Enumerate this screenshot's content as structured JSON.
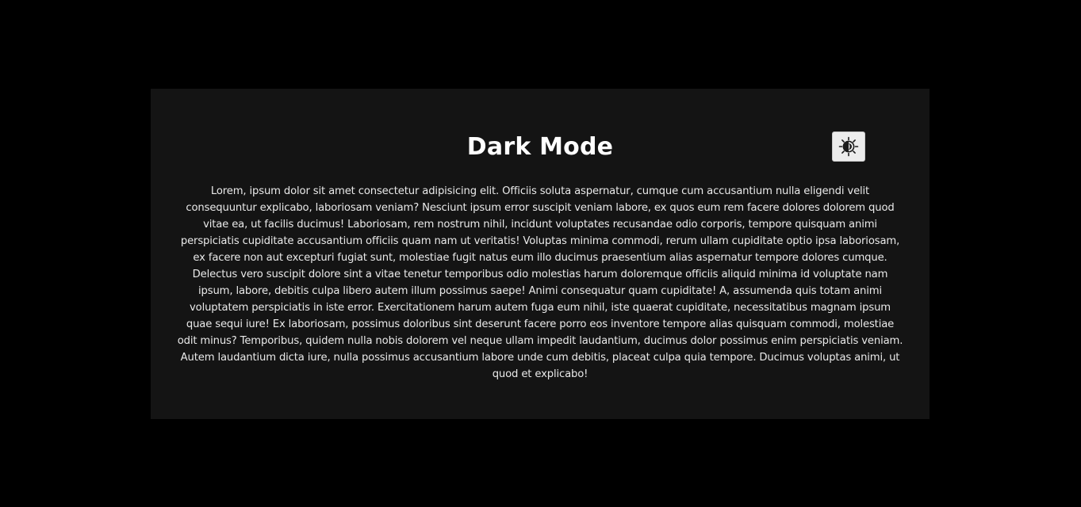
{
  "page": {
    "background": "#000000",
    "card_background": "#141414",
    "text_color": "#e9e9e9",
    "title_color": "#ffffff"
  },
  "header": {
    "title": "Dark Mode"
  },
  "theme_toggle": {
    "icon": "sun-moon-icon",
    "background": "#ececec"
  },
  "content": {
    "paragraph": "Lorem, ipsum dolor sit amet consectetur adipisicing elit. Officiis soluta aspernatur, cumque cum accusantium nulla eligendi velit consequuntur explicabo, laboriosam veniam? Nesciunt ipsum error suscipit veniam labore, ex quos eum rem facere dolores dolorem quod vitae ea, ut facilis ducimus! Laboriosam, rem nostrum nihil, incidunt voluptates recusandae odio corporis, tempore quisquam animi perspiciatis cupiditate accusantium officiis quam nam ut veritatis! Voluptas minima commodi, rerum ullam cupiditate optio ipsa laboriosam, ex facere non aut excepturi fugiat sunt, molestiae fugit natus eum illo ducimus praesentium alias aspernatur tempore dolores cumque. Delectus vero suscipit dolore sint a vitae tenetur temporibus odio molestias harum doloremque officiis aliquid minima id voluptate nam ipsum, labore, debitis culpa libero autem illum possimus saepe! Animi consequatur quam cupiditate! A, assumenda quis totam animi voluptatem perspiciatis in iste error. Exercitationem harum autem fuga eum nihil, iste quaerat cupiditate, necessitatibus magnam ipsum quae sequi iure! Ex laboriosam, possimus doloribus sint deserunt facere porro eos inventore tempore alias quisquam commodi, molestiae odit minus? Temporibus, quidem nulla nobis dolorem vel neque ullam impedit laudantium, ducimus dolor possimus enim perspiciatis veniam. Autem laudantium dicta iure, nulla possimus accusantium labore unde cum debitis, placeat culpa quia tempore. Ducimus voluptas animi, ut quod et explicabo!"
  }
}
